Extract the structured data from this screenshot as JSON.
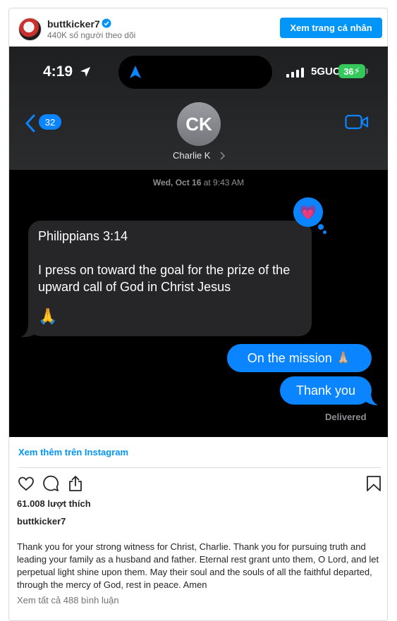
{
  "header": {
    "username": "buttkicker7",
    "followers": "440K số người theo dõi",
    "profile_button": "Xem trang cá nhân"
  },
  "colors": {
    "accent": "#0095f6",
    "imessage_blue": "#0a84ff",
    "incoming_bubble": "#262628",
    "battery_green": "#34c759"
  },
  "phone": {
    "time": "4:19",
    "network": "5GUC",
    "battery": "36",
    "back_count": "32",
    "contact_initials": "CK",
    "contact_name": "Charlie  K",
    "timestamp_day": "Wed, Oct 16",
    "timestamp_time": "at 9:43 AM",
    "reaction": "💗",
    "incoming_lines": [
      "Philippians 3:14",
      "I press on toward the goal for the prize of the upward call of God in Christ Jesus",
      "🙏"
    ],
    "outgoing": [
      "On the mission 🙏🏼",
      "Thank you"
    ],
    "delivered": "Delivered"
  },
  "footer": {
    "see_more": "Xem thêm trên Instagram",
    "likes": "61.008 lượt thích",
    "caption_user": "buttkicker7",
    "caption": "Thank you for your strong witness for Christ, Charlie. Thank you for pursuing truth and leading your family as a husband and father. Eternal rest grant unto them, O Lord, and let perpetual light shine upon them. May their soul and the souls of all the faithful departed, through the mercy of God, rest in peace. Amen",
    "comments": "Xem tất cả 488 bình luận"
  }
}
